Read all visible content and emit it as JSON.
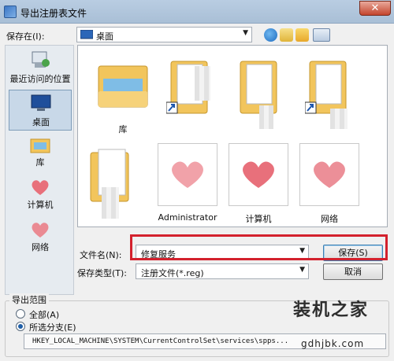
{
  "window": {
    "title": "导出注册表文件",
    "close_glyph": "✕"
  },
  "toolbar": {
    "save_in_label": "保存在(I):",
    "location": "桌面"
  },
  "places": [
    {
      "label": "最近访问的位置",
      "icon": "recent-places-icon"
    },
    {
      "label": "桌面",
      "icon": "desktop-icon",
      "selected": true
    },
    {
      "label": "库",
      "icon": "libraries-icon"
    },
    {
      "label": "计算机",
      "icon": "heart-icon"
    },
    {
      "label": "网络",
      "icon": "heart-icon"
    }
  ],
  "files": [
    {
      "name": "库",
      "kind": "library-folder"
    },
    {
      "name": "",
      "kind": "shortcut-folder"
    },
    {
      "name": "",
      "kind": "shortcut-folder"
    },
    {
      "name": "",
      "kind": "shortcut-folder"
    },
    {
      "name": "",
      "kind": "folder"
    },
    {
      "name": "Administrator",
      "kind": "heart-thumb"
    },
    {
      "name": "计算机",
      "kind": "heart-thumb"
    },
    {
      "name": "网络",
      "kind": "heart-thumb"
    }
  ],
  "form": {
    "filename_label": "文件名(N):",
    "filename_value": "修复服务",
    "filetype_label": "保存类型(T):",
    "filetype_value": "注册文件(*.reg)",
    "save_button": "保存(S)",
    "cancel_button": "取消"
  },
  "export_range": {
    "title": "导出范围",
    "all_label": "全部(A)",
    "branch_label": "所选分支(E)",
    "selected": "branch",
    "branch_path": "HKEY_LOCAL_MACHINE\\SYSTEM\\CurrentControlSet\\services\\spps..."
  },
  "watermark": {
    "text": "装机之家",
    "url": "gdhjbk.com"
  },
  "colors": {
    "highlight": "#d3212d",
    "folder": "#f2c55c",
    "heart": "#e8707b"
  }
}
